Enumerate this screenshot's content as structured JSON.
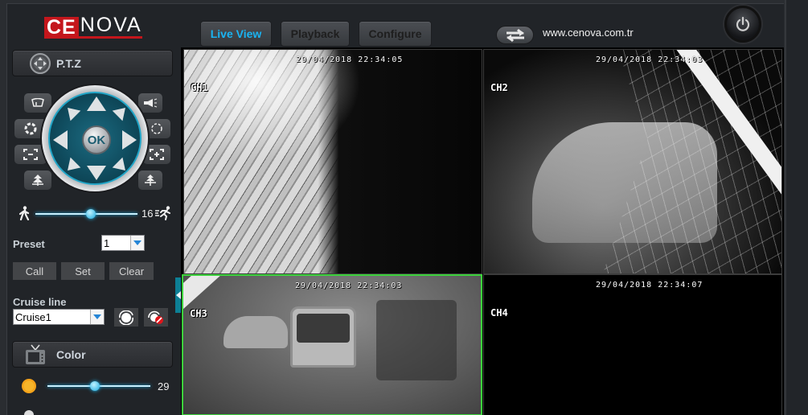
{
  "header": {
    "logo_part1": "CE",
    "logo_part2": "NOVA",
    "tabs": [
      {
        "label": "Live View",
        "active": true
      },
      {
        "label": "Playback",
        "active": false
      },
      {
        "label": "Configure",
        "active": false
      }
    ],
    "swap_icon": "swap-arrows-icon",
    "website": "www.cenova.com.tr",
    "power_icon": "power-icon"
  },
  "colors": {
    "accent": "#1ab4f2",
    "brand_red": "#c4161c",
    "selected_border": "#3cd23c",
    "handle": "#0d7f95"
  },
  "ptz": {
    "title": "P.T.Z",
    "title_icon": "ptz-dpad-icon",
    "ok_label": "OK",
    "left_buttons": [
      "wiper-icon",
      "iris-close-icon",
      "zoom-out-icon",
      "focus-near-icon"
    ],
    "right_buttons": [
      "light-icon",
      "iris-open-icon",
      "zoom-in-icon",
      "focus-far-icon"
    ],
    "directions": [
      "up",
      "up-right",
      "right",
      "down-right",
      "down",
      "down-left",
      "left",
      "up-left"
    ],
    "speed": {
      "value": 16,
      "min": 1,
      "max": 30,
      "fraction": 0.54,
      "slow_icon": "walk-icon",
      "fast_icon": "run-icon"
    },
    "preset_label": "Preset",
    "preset_value": "1",
    "buttons": [
      "Call",
      "Set",
      "Clear"
    ],
    "cruise_label": "Cruise line",
    "cruise_value": "Cruise1",
    "cruise_start_icon": "cruise-start-icon",
    "cruise_stop_icon": "cruise-stop-icon"
  },
  "color": {
    "title": "Color",
    "title_icon": "tv-icon",
    "brightness": {
      "value": 29,
      "fraction": 0.46,
      "icon": "sun-icon"
    }
  },
  "channels": [
    {
      "name": "CH1",
      "timestamp": "29/04/2018 22:34:05",
      "selected": false
    },
    {
      "name": "CH2",
      "timestamp": "29/04/2018 22:34:03",
      "selected": false
    },
    {
      "name": "CH3",
      "timestamp": "29/04/2018 22:34:03",
      "selected": true
    },
    {
      "name": "CH4",
      "timestamp": "29/04/2018 22:34:07",
      "selected": false
    }
  ]
}
